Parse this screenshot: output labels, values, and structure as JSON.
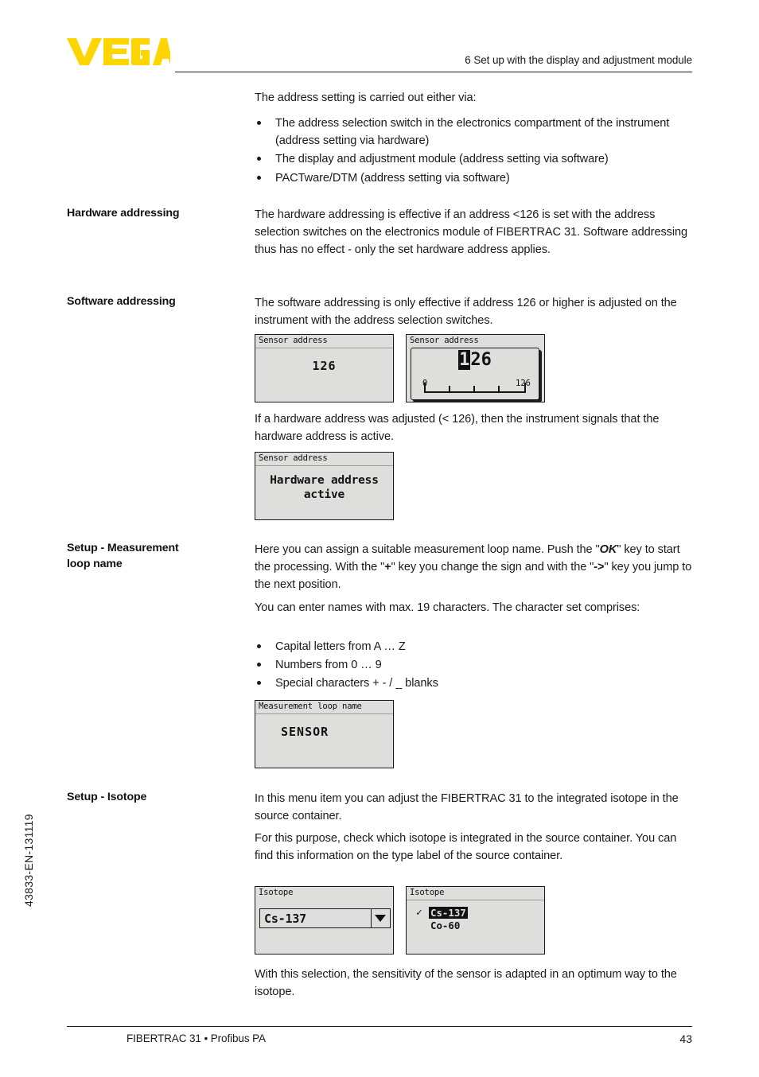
{
  "brand": {
    "logo_text": "VEGA",
    "logo_color": "#ffd500"
  },
  "header": {
    "chapter_title": "6 Set up with the display and adjustment module"
  },
  "side_code": "43833-EN-131119",
  "footer": {
    "document_name": "FIBERTRAC 31 • Profibus PA",
    "page_number": "43"
  },
  "intro": {
    "lead": "The address setting is carried out either via:",
    "bullets": [
      "The address selection switch in the electronics compartment of the instrument (address setting via hardware)",
      "The display and adjustment module (address setting via software)",
      "PACTware/DTM (address setting via software)"
    ]
  },
  "sections": [
    {
      "marginal": "Hardware addressing",
      "paragraphs": [
        "The hardware addressing is effective if an address <126 is set with the address selection switches on the electronics module of FIBERTRAC 31. Software addressing thus has no effect - only the set hardware address applies."
      ]
    },
    {
      "marginal": "Software addressing",
      "paragraphs": [
        "The software addressing is only effective if address 126 or higher is adjusted on the instrument with the address selection switches.",
        "If a hardware address was adjusted (< 126), then the instrument signals that the hardware address is active."
      ]
    },
    {
      "marginal_line1": "Setup - Measurement",
      "marginal_line2": "loop name",
      "paragraph_rich_pre": "Here you can assign a suitable measurement loop name. Push the \"",
      "paragraph_ok": "OK",
      "paragraph_rich_mid1": "\" key to start the processing. With the \"",
      "paragraph_plus": "+",
      "paragraph_rich_mid2": "\" key you change the sign and with the \"",
      "paragraph_arrow": "->",
      "paragraph_rich_post": "\" key you jump to the next position.",
      "paragraph2": "You can enter names with max. 19 characters. The character set comprises:",
      "charset_bullets": [
        "Capital letters from A … Z",
        "Numbers from 0 … 9",
        "Special characters + - / _ blanks"
      ]
    },
    {
      "marginal": "Setup - Isotope",
      "paragraphs": [
        "In this menu item you can adjust the FIBERTRAC 31 to the integrated isotope in the source container.",
        "For this purpose, check which isotope is integrated in the source container. You can find this information on the type label of the source container.",
        "With this selection, the sensitivity of the sensor is adapted in an optimum way to the isotope."
      ]
    }
  ],
  "displays": {
    "sensor_address_static": {
      "title": "Sensor address",
      "value": "126"
    },
    "sensor_address_edit": {
      "title": "Sensor address",
      "value_selected_digit": "1",
      "value_rest": "26",
      "scale_min": "0",
      "scale_max": "126"
    },
    "hardware_address_active": {
      "title": "Sensor address",
      "line1": "Hardware address",
      "line2": "active"
    },
    "measurement_loop_name": {
      "title": "Measurement loop name",
      "value": "SENSOR"
    },
    "isotope_closed": {
      "title": "Isotope",
      "selected": "Cs-137",
      "arrow_icon": "chevron-down-icon"
    },
    "isotope_open": {
      "title": "Isotope",
      "options": [
        {
          "label": "Cs-137",
          "checked": true,
          "highlighted": true,
          "check_glyph": "✓"
        },
        {
          "label": "Co-60",
          "checked": false,
          "highlighted": false,
          "check_glyph": ""
        }
      ]
    }
  }
}
